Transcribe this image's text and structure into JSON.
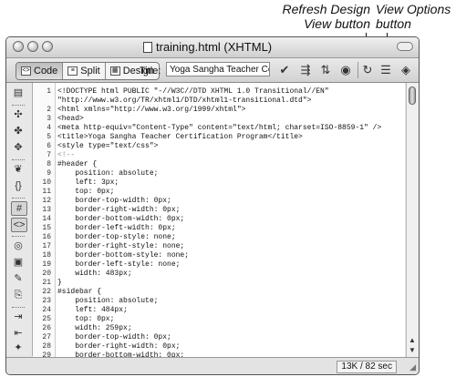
{
  "callouts": {
    "refresh": [
      "Refresh Design",
      "View button"
    ],
    "view_options": [
      "View Options",
      "button"
    ]
  },
  "window": {
    "title": "training.html (XHTML)"
  },
  "toolbar": {
    "code_label": "Code",
    "split_label": "Split",
    "design_label": "Design",
    "title_label": "Title:",
    "title_value": "Yoga Sangha Teacher Certificat"
  },
  "icons": {
    "toolbar": [
      "file-management-icon",
      "preview-browser-icon",
      "debug-icon",
      "visual-aids-icon",
      "validate-icon",
      "refresh-icon",
      "view-options-icon",
      "visual-aids-eye-icon"
    ],
    "left": [
      "open-documents-icon",
      "collapse-tag-icon",
      "collapse-selection-icon",
      "expand-all-icon",
      "select-parent-tag-icon",
      "balance-braces-icon",
      "line-numbers-icon",
      "highlight-invalid-icon",
      "syntax-coloring-icon",
      "apply-comment-icon",
      "remove-comment-icon",
      "wrap-tag-icon",
      "recent-snippets-icon",
      "indent-icon",
      "outdent-icon",
      "format-source-icon"
    ]
  },
  "code": {
    "lines": [
      {
        "n": "1",
        "t": "<!DOCTYPE html PUBLIC \"-//W3C//DTD XHTML 1.0 Transitional//EN\""
      },
      {
        "n": "",
        "t": "\"http://www.w3.org/TR/xhtml1/DTD/xhtml1-transitional.dtd\">"
      },
      {
        "n": "2",
        "t": "<html xmlns=\"http://www.w3.org/1999/xhtml\">"
      },
      {
        "n": "3",
        "t": "<head>"
      },
      {
        "n": "4",
        "t": "<meta http-equiv=\"Content-Type\" content=\"text/html; charset=ISO-8859-1\" />"
      },
      {
        "n": "5",
        "t": "<title>Yoga Sangha Teacher Certification Program</title>"
      },
      {
        "n": "6",
        "t": "<style type=\"text/css\">"
      },
      {
        "n": "7",
        "t": "<!--"
      },
      {
        "n": "8",
        "t": "#header {"
      },
      {
        "n": "9",
        "t": "    position: absolute;"
      },
      {
        "n": "10",
        "t": "    left: 3px;"
      },
      {
        "n": "11",
        "t": "    top: 0px;"
      },
      {
        "n": "12",
        "t": "    border-top-width: 0px;"
      },
      {
        "n": "13",
        "t": "    border-right-width: 0px;"
      },
      {
        "n": "14",
        "t": "    border-bottom-width: 0px;"
      },
      {
        "n": "15",
        "t": "    border-left-width: 0px;"
      },
      {
        "n": "16",
        "t": "    border-top-style: none;"
      },
      {
        "n": "17",
        "t": "    border-right-style: none;"
      },
      {
        "n": "18",
        "t": "    border-bottom-style: none;"
      },
      {
        "n": "19",
        "t": "    border-left-style: none;"
      },
      {
        "n": "20",
        "t": "    width: 483px;"
      },
      {
        "n": "21",
        "t": "}"
      },
      {
        "n": "22",
        "t": "#sidebar {"
      },
      {
        "n": "23",
        "t": "    position: absolute;"
      },
      {
        "n": "24",
        "t": "    left: 484px;"
      },
      {
        "n": "25",
        "t": "    top: 0px;"
      },
      {
        "n": "26",
        "t": "    width: 259px;"
      },
      {
        "n": "27",
        "t": "    border-top-width: 0px;"
      },
      {
        "n": "28",
        "t": "    border-right-width: 0px;"
      },
      {
        "n": "29",
        "t": "    border-bottom-width: 0px;"
      }
    ]
  },
  "status": {
    "size_time": "13K / 82 sec"
  }
}
